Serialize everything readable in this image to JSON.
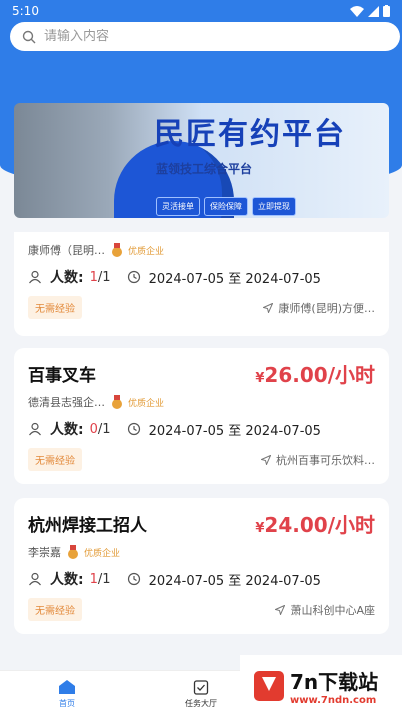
{
  "status_bar": {
    "time": "5:10"
  },
  "search": {
    "placeholder": "请输入内容"
  },
  "banner": {
    "title": "民匠有约平台",
    "subtitle": "蓝领技工综合平台",
    "tags": [
      "灵活接单",
      "保险保障",
      "立即提现"
    ]
  },
  "jobs": [
    {
      "company": "康师傅（昆明…",
      "badge": "优质企业",
      "count_label": "人数:",
      "hired": "1",
      "total": "1",
      "date_range": "2024-07-05 至 2024-07-05",
      "experience": "无需经验",
      "location": "康师傅(昆明)方便…"
    },
    {
      "title": "百事叉车",
      "price": "26.00",
      "price_currency": "¥",
      "price_unit": "/小时",
      "company": "德清县志强企…",
      "badge": "优质企业",
      "count_label": "人数:",
      "hired": "0",
      "total": "1",
      "date_range": "2024-07-05 至 2024-07-05",
      "experience": "无需经验",
      "location": "杭州百事可乐饮料…"
    },
    {
      "title": "杭州焊接工招人",
      "price": "24.00",
      "price_currency": "¥",
      "price_unit": "/小时",
      "company": "李崇嘉",
      "badge": "优质企业",
      "count_label": "人数:",
      "hired": "1",
      "total": "1",
      "date_range": "2024-07-05 至 2024-07-05",
      "experience": "无需经验",
      "location": "萧山科创中心A座"
    }
  ],
  "tabbar": {
    "home": "首页",
    "tasks": "任务大厅"
  },
  "watermark": {
    "main": "7n下载站",
    "sub": "www.7ndn.com"
  },
  "colors": {
    "primary": "#2f7de8",
    "price": "#e0424a",
    "badge": "#e29a35"
  }
}
